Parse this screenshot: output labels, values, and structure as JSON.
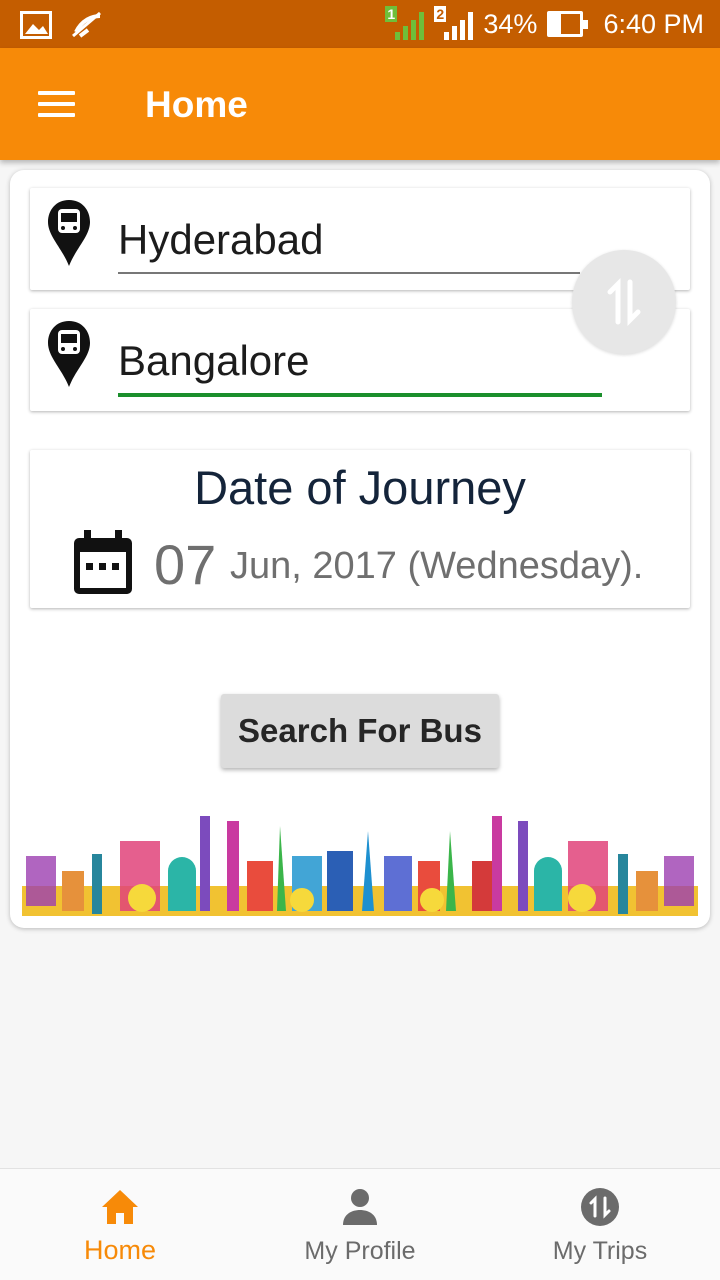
{
  "status_bar": {
    "sim1": "1",
    "sim2": "2",
    "battery": "34%",
    "time": "6:40 PM"
  },
  "app_bar": {
    "title": "Home",
    "menu_icon": "hamburger-menu-icon"
  },
  "search_form": {
    "from_city": "Hyderabad",
    "to_city": "Bangalore",
    "swap_icon": "swap-vertical-icon"
  },
  "journey": {
    "title": "Date of Journey",
    "day": "07",
    "rest": "Jun, 2017 (Wednesday)."
  },
  "actions": {
    "search_label": "Search For Bus"
  },
  "bottom_nav": {
    "items": [
      {
        "label": "Home",
        "icon": "home-icon",
        "active": true
      },
      {
        "label": "My Profile",
        "icon": "person-icon",
        "active": false
      },
      {
        "label": "My Trips",
        "icon": "trips-swap-icon",
        "active": false
      }
    ]
  },
  "colors": {
    "primary": "#f78a08",
    "status_bar": "#c45d00",
    "accent_green": "#1b8f2c"
  }
}
